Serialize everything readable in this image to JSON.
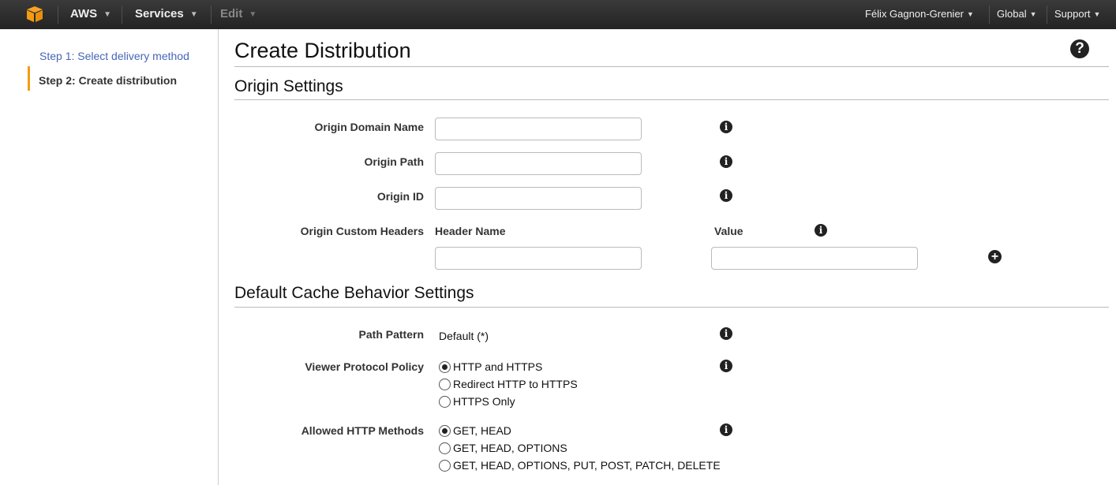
{
  "topnav": {
    "brand": "AWS",
    "services": "Services",
    "edit": "Edit",
    "user": "Félix Gagnon-Grenier",
    "region": "Global",
    "support": "Support"
  },
  "sidebar": {
    "steps": [
      {
        "label": "Step 1: Select delivery method"
      },
      {
        "label": "Step 2: Create distribution"
      }
    ]
  },
  "page": {
    "title": "Create Distribution",
    "help_icon": "?"
  },
  "origin": {
    "title": "Origin Settings",
    "domain_name": {
      "label": "Origin Domain Name",
      "value": ""
    },
    "path": {
      "label": "Origin Path",
      "value": ""
    },
    "id": {
      "label": "Origin ID",
      "value": ""
    },
    "custom_headers": {
      "label": "Origin Custom Headers",
      "header_name_label": "Header Name",
      "value_label": "Value",
      "header_name_value": "",
      "value_value": ""
    }
  },
  "cache": {
    "title": "Default Cache Behavior Settings",
    "path_pattern": {
      "label": "Path Pattern",
      "value": "Default (*)"
    },
    "viewer_protocol": {
      "label": "Viewer Protocol Policy",
      "options": [
        {
          "label": "HTTP and HTTPS",
          "selected": true
        },
        {
          "label": "Redirect HTTP to HTTPS",
          "selected": false
        },
        {
          "label": "HTTPS Only",
          "selected": false
        }
      ]
    },
    "allowed_methods": {
      "label": "Allowed HTTP Methods",
      "options": [
        {
          "label": "GET, HEAD",
          "selected": true
        },
        {
          "label": "GET, HEAD, OPTIONS",
          "selected": false
        },
        {
          "label": "GET, HEAD, OPTIONS, PUT, POST, PATCH, DELETE",
          "selected": false
        }
      ]
    }
  },
  "icons": {
    "info": "i",
    "add": "+"
  },
  "colors": {
    "accent": "#f39c12",
    "link": "#4766b8",
    "nav_bg": "#2b2b2b"
  }
}
